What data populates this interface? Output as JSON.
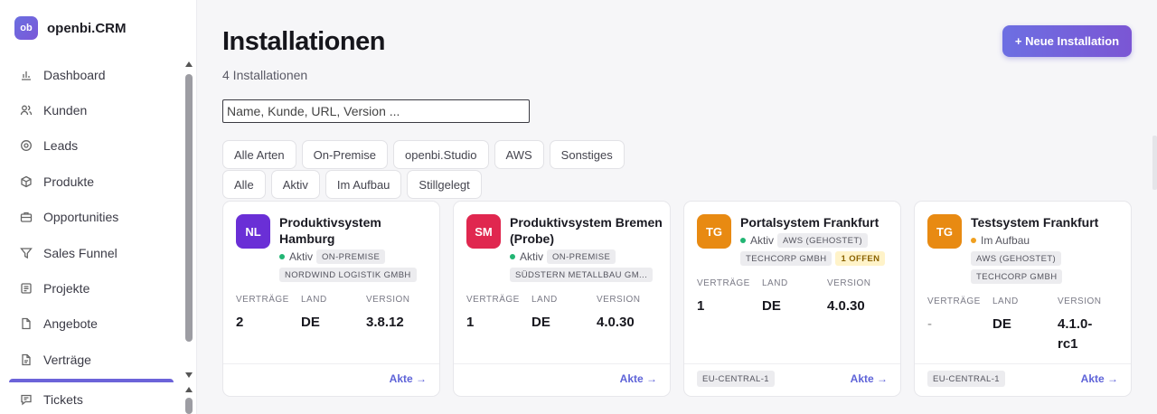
{
  "brand": {
    "logo": "ob",
    "name": "openbi.CRM"
  },
  "nav": [
    {
      "label": "Dashboard",
      "icon": "chart-icon"
    },
    {
      "label": "Kunden",
      "icon": "users-icon"
    },
    {
      "label": "Leads",
      "icon": "target-icon"
    },
    {
      "label": "Produkte",
      "icon": "box-icon"
    },
    {
      "label": "Opportunities",
      "icon": "briefcase-icon"
    },
    {
      "label": "Sales Funnel",
      "icon": "funnel-icon"
    },
    {
      "label": "Projekte",
      "icon": "clipboard-icon"
    },
    {
      "label": "Angebote",
      "icon": "file-icon"
    },
    {
      "label": "Verträge",
      "icon": "contract-icon"
    }
  ],
  "nav_bottom": {
    "label": "Tickets",
    "icon": "ticket-icon"
  },
  "header": {
    "title": "Installationen",
    "count": "4 Installationen",
    "new_button": "+ Neue Installation"
  },
  "search": {
    "placeholder": "Name, Kunde, URL, Version ...",
    "value": ""
  },
  "filters": {
    "types": [
      "Alle Arten",
      "On-Premise",
      "openbi.Studio",
      "AWS",
      "Sonstiges"
    ],
    "statuses": [
      "Alle",
      "Aktiv",
      "Im Aufbau",
      "Stillgelegt"
    ]
  },
  "labels": {
    "contracts": "VERTRÄGE",
    "country": "LAND",
    "version": "VERSION",
    "file_link": "Akte →"
  },
  "cards": [
    {
      "initials": "NL",
      "avatar_color": "#6a2fd6",
      "title": "Produktivsystem Hamburg",
      "status": "Aktiv",
      "status_color": "#22b573",
      "tags": [
        "ON-PREMISE",
        "NORDWIND LOGISTIK GMBH"
      ],
      "warn": "",
      "contracts": "2",
      "country": "DE",
      "version": "3.8.12",
      "region": ""
    },
    {
      "initials": "SM",
      "avatar_color": "#e0274f",
      "title": "Produktivsystem Bremen (Probe)",
      "status": "Aktiv",
      "status_color": "#22b573",
      "tags": [
        "ON-PREMISE",
        "SÜDSTERN METALLBAU GM..."
      ],
      "warn": "",
      "contracts": "1",
      "country": "DE",
      "version": "4.0.30",
      "region": ""
    },
    {
      "initials": "TG",
      "avatar_color": "#e88a12",
      "title": "Portalsystem Frankfurt",
      "status": "Aktiv",
      "status_color": "#22b573",
      "tags": [
        "AWS (GEHOSTET)",
        "TECHCORP GMBH"
      ],
      "warn": "1 OFFEN",
      "contracts": "1",
      "country": "DE",
      "version": "4.0.30",
      "region": "EU-CENTRAL-1"
    },
    {
      "initials": "TG",
      "avatar_color": "#e88a12",
      "title": "Testsystem Frankfurt",
      "status": "Im Aufbau",
      "status_color": "#f0a020",
      "tags": [
        "AWS (GEHOSTET)",
        "TECHCORP GMBH"
      ],
      "warn": "",
      "contracts": "-",
      "country": "DE",
      "version": "4.1.0-rc1",
      "region": "EU-CENTRAL-1"
    }
  ]
}
